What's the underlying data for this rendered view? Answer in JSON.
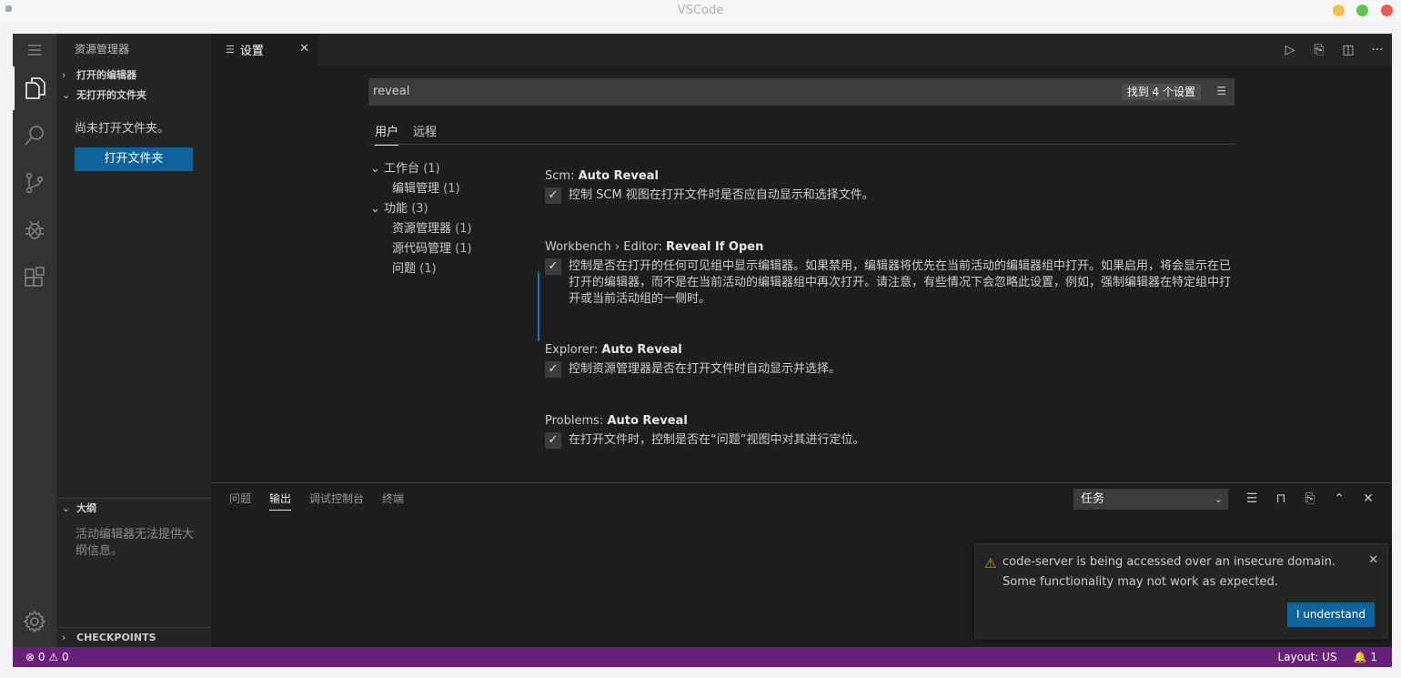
{
  "window": {
    "title": "VSCode"
  },
  "colors": {
    "statusbar": "#68217a",
    "button": "#0e639c",
    "focus": "#007fd4",
    "warning": "#cca700"
  },
  "sidebar": {
    "title": "资源管理器",
    "sections": {
      "open_editors": "打开的编辑器",
      "no_folder": "无打开的文件夹",
      "outline": "大纲",
      "checkpoints": "CHECKPOINTS"
    },
    "no_folder_msg": "尚未打开文件夹。",
    "open_folder_btn": "打开文件夹",
    "outline_msg": "活动编辑器无法提供大纲信息。"
  },
  "tab": {
    "label": "设置"
  },
  "settings": {
    "search_value": "reveal",
    "result_count": "找到 4 个设置",
    "scope_tabs": [
      "用户",
      "远程"
    ],
    "toc": [
      {
        "label": "工作台",
        "count": "(1)"
      },
      {
        "label": "编辑管理",
        "count": "(1)"
      },
      {
        "label": "功能",
        "count": "(3)"
      },
      {
        "label": "资源管理器",
        "count": "(1)"
      },
      {
        "label": "源代码管理",
        "count": "(1)"
      },
      {
        "label": "问题",
        "count": "(1)"
      }
    ],
    "items": [
      {
        "category": "Scm: ",
        "name": "Auto Reveal",
        "desc": "控制 SCM 视图在打开文件时是否应自动显示和选择文件。"
      },
      {
        "category": "Workbench › Editor: ",
        "name": "Reveal If Open",
        "desc": "控制是否在打开的任何可见组中显示编辑器。如果禁用，编辑器将优先在当前活动的编辑器组中打开。如果启用，将会显示在已打开的编辑器，而不是在当前活动的编辑器组中再次打开。请注意，有些情况下会忽略此设置，例如，强制编辑器在特定组中打开或当前活动组的一侧时。"
      },
      {
        "category": "Explorer: ",
        "name": "Auto Reveal",
        "desc": "控制资源管理器是否在打开文件时自动显示并选择。"
      },
      {
        "category": "Problems: ",
        "name": "Auto Reveal",
        "desc": "在打开文件时，控制是否在“问题”视图中对其进行定位。"
      }
    ]
  },
  "panel": {
    "tabs": [
      "问题",
      "输出",
      "调试控制台",
      "终端"
    ],
    "active_tab": "输出",
    "select_value": "任务"
  },
  "notification": {
    "message": "code-server is being accessed over an insecure domain. Some functionality may not work as expected.",
    "button": "I understand"
  },
  "statusbar": {
    "errors": "0",
    "warnings": "0",
    "layout": "Layout: US",
    "notifications": "1"
  }
}
